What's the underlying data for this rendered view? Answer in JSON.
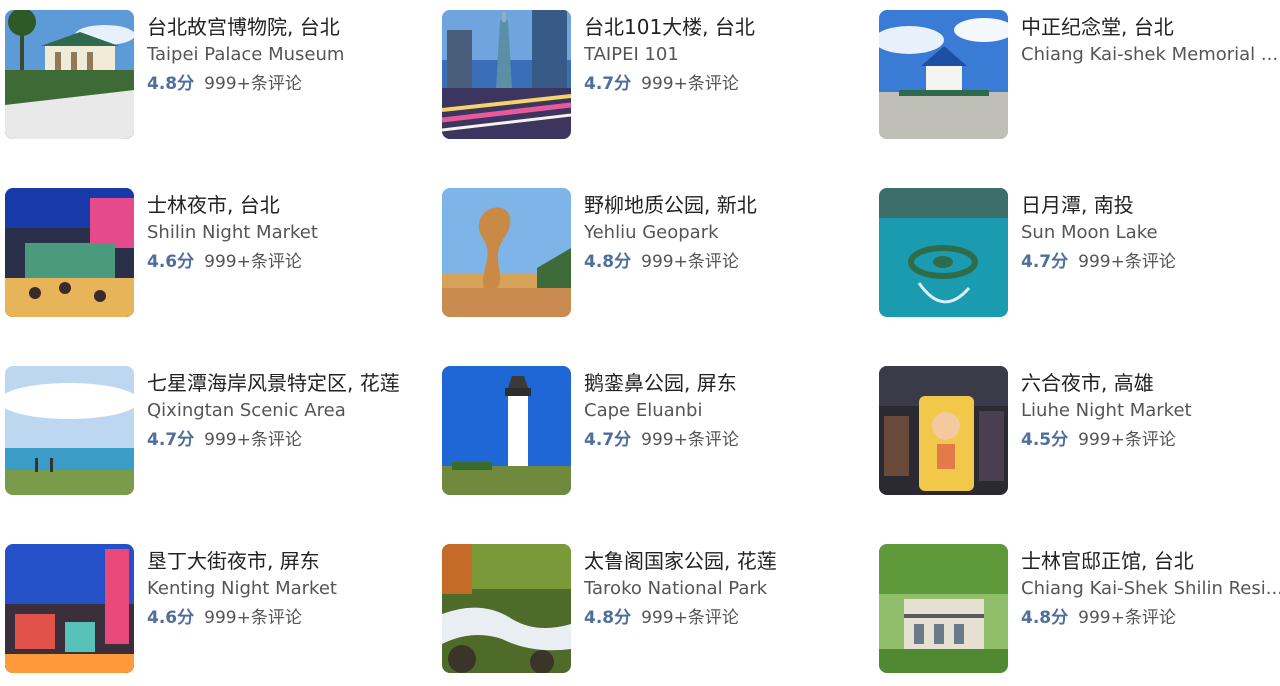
{
  "score_color": "#4f6e9c",
  "attractions": [
    {
      "title": "台北故宫博物院, 台北",
      "subtitle": "Taipei Palace Museum",
      "score": "4.8分",
      "reviews": "999+条评论",
      "thumb": "palace-museum"
    },
    {
      "title": "台北101大楼, 台北",
      "subtitle": "TAIPEI 101",
      "score": "4.7分",
      "reviews": "999+条评论",
      "thumb": "taipei-101"
    },
    {
      "title": "中正纪念堂, 台北",
      "subtitle": "Chiang Kai-shek Memorial ...",
      "score": "",
      "reviews": "",
      "thumb": "memorial-hall"
    },
    {
      "title": "士林夜市, 台北",
      "subtitle": "Shilin Night Market",
      "score": "4.6分",
      "reviews": "999+条评论",
      "thumb": "shilin-market"
    },
    {
      "title": "野柳地质公园, 新北",
      "subtitle": "Yehliu Geopark",
      "score": "4.8分",
      "reviews": "999+条评论",
      "thumb": "yehliu-rock"
    },
    {
      "title": "日月潭, 南投",
      "subtitle": "Sun Moon Lake",
      "score": "4.7分",
      "reviews": "999+条评论",
      "thumb": "sun-moon-lake"
    },
    {
      "title": "七星潭海岸风景特定区, 花莲",
      "subtitle": "Qixingtan Scenic Area",
      "score": "4.7分",
      "reviews": "999+条评论",
      "thumb": "qixingtan-coast"
    },
    {
      "title": "鹅銮鼻公园, 屏东",
      "subtitle": "Cape Eluanbi",
      "score": "4.7分",
      "reviews": "999+条评论",
      "thumb": "lighthouse"
    },
    {
      "title": "六合夜市, 高雄",
      "subtitle": "Liuhe Night Market",
      "score": "4.5分",
      "reviews": "999+条评论",
      "thumb": "liuhe-market"
    },
    {
      "title": "垦丁大街夜市, 屏东",
      "subtitle": "Kenting Night Market",
      "score": "4.6分",
      "reviews": "999+条评论",
      "thumb": "kenting-street"
    },
    {
      "title": "太鲁阁国家公园, 花莲",
      "subtitle": "Taroko National Park",
      "score": "4.8分",
      "reviews": "999+条评论",
      "thumb": "taroko-stream"
    },
    {
      "title": "士林官邸正馆, 台北",
      "subtitle": "Chiang Kai-Shek Shilin Resi...",
      "score": "4.8分",
      "reviews": "999+条评论",
      "thumb": "shilin-residence"
    }
  ]
}
